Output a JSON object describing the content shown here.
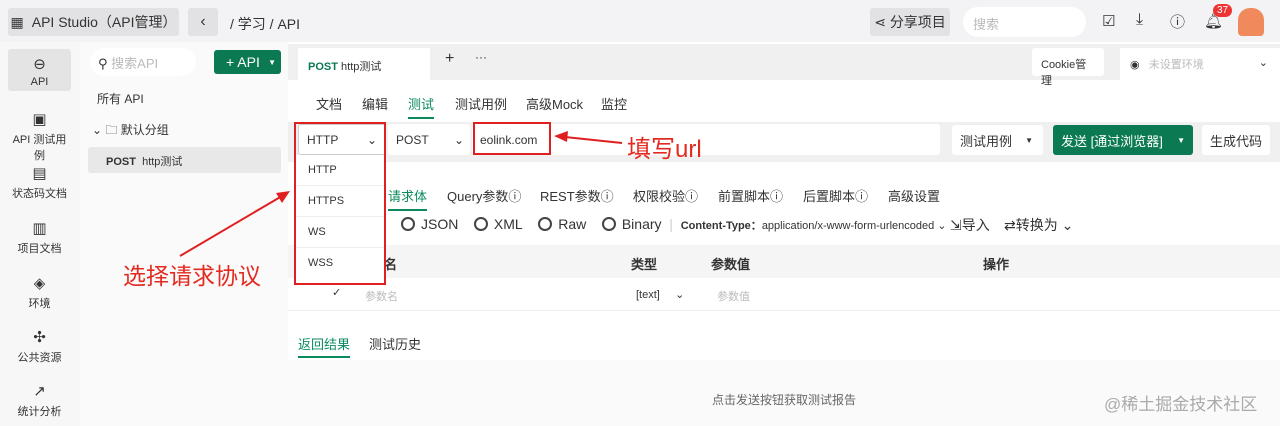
{
  "topbar": {
    "app_title": "API Studio（API管理）",
    "breadcrumb": "/ 学习 / API",
    "share": "分享项目",
    "search_placeholder": "搜索",
    "notif_count": "37"
  },
  "sidebar": {
    "items": [
      {
        "label": "API",
        "icon": "link-icon"
      },
      {
        "label": "API 测试用例",
        "icon": "clipboard-check-icon"
      },
      {
        "label": "状态码文档",
        "icon": "doc-icon"
      },
      {
        "label": "项目文档",
        "icon": "book-icon"
      },
      {
        "label": "环境",
        "icon": "cube-icon"
      },
      {
        "label": "公共资源",
        "icon": "puzzle-icon"
      },
      {
        "label": "统计分析",
        "icon": "chart-icon"
      }
    ]
  },
  "list": {
    "search_placeholder": "搜索API",
    "add_label": "+ API",
    "all": "所有 API",
    "group": "默认分组",
    "item_method": "POST",
    "item_name": "http测试"
  },
  "tabs": {
    "method": "POST",
    "name": "http测试",
    "cookie": "Cookie管理",
    "env": "未设置环境"
  },
  "subtabs": [
    "文档",
    "编辑",
    "测试",
    "测试用例",
    "高级Mock",
    "监控"
  ],
  "url": {
    "protocol": "HTTP",
    "method": "POST",
    "value": "eolink.com",
    "testcase": "测试用例",
    "send": "发送 [通过浏览器]",
    "gen": "生成代码"
  },
  "protocol_options": [
    "HTTP",
    "HTTPS",
    "WS",
    "WSS"
  ],
  "req_tabs": [
    "请求体",
    "Query参数ⓘ",
    "REST参数ⓘ",
    "权限校验ⓘ",
    "前置脚本ⓘ",
    "后置脚本ⓘ",
    "高级设置"
  ],
  "body": {
    "types": [
      "JSON",
      "XML",
      "Raw",
      "Binary"
    ],
    "ct_label": "Content-Type：",
    "ct_value": "application/x-www-form-urlencoded",
    "import": "导入",
    "convert": "转换为"
  },
  "table": {
    "headers": [
      "名",
      "类型",
      "参数值",
      "操作"
    ],
    "row": {
      "name_ph": "参数名",
      "type": "[text]",
      "value_ph": "参数值"
    }
  },
  "result": {
    "tabs": [
      "返回结果",
      "测试历史"
    ],
    "empty": "点击发送按钮获取测试报告"
  },
  "annotations": {
    "protocol": "选择请求协议",
    "url": "填写url"
  },
  "watermark": "@稀土掘金技术社区"
}
